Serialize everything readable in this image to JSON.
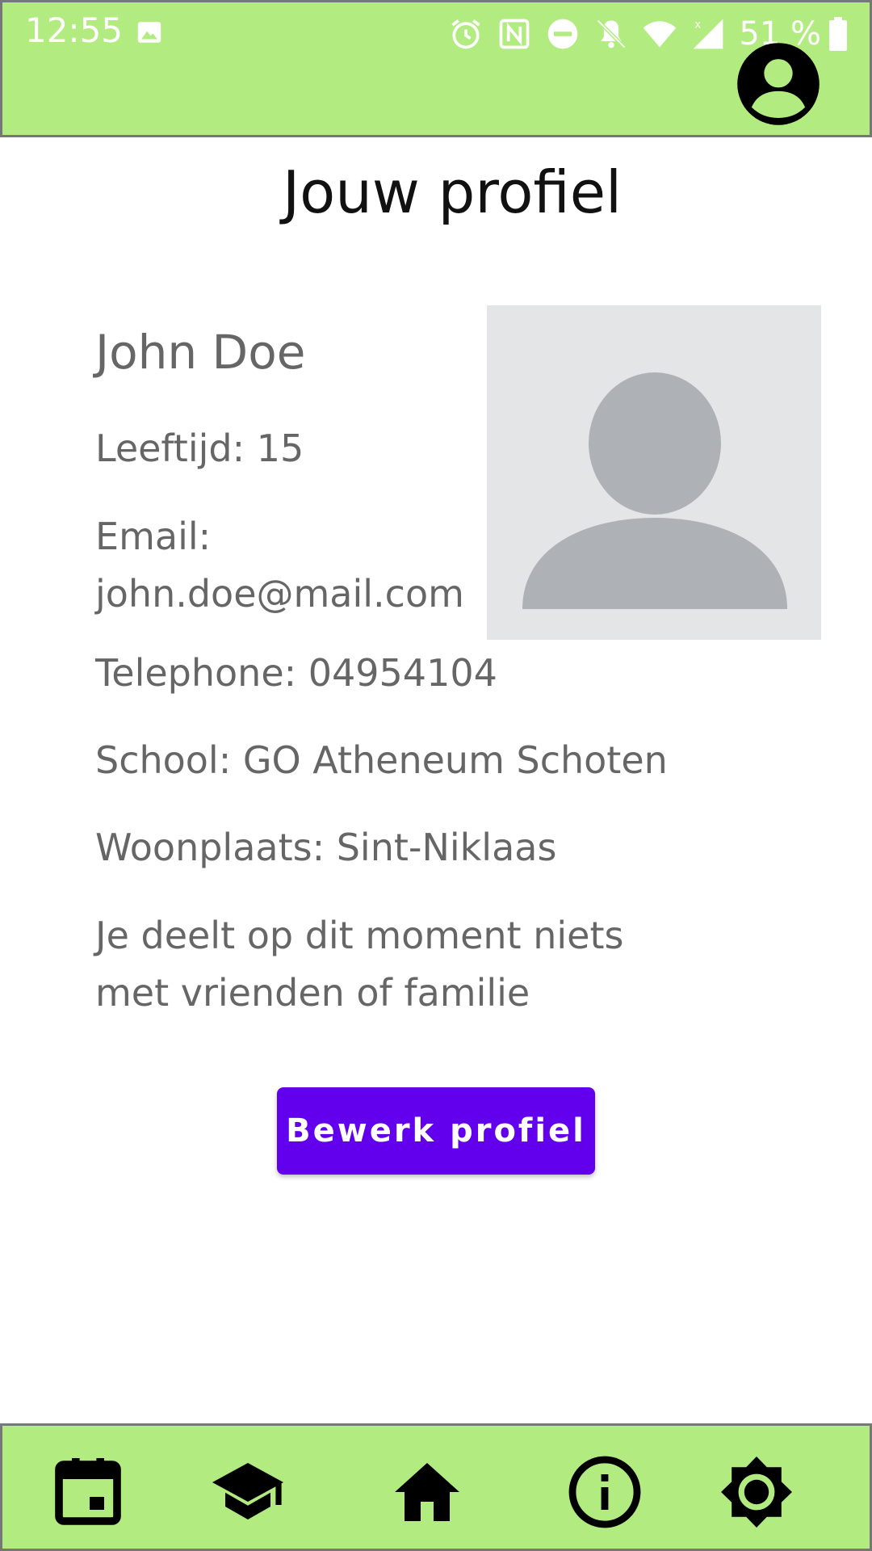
{
  "status_bar": {
    "time": "12:55",
    "battery": "51 %",
    "icons": [
      "image-icon",
      "alarm-icon",
      "nfc-icon",
      "dnd-icon",
      "bell-off-icon",
      "wifi-icon",
      "signal-icon",
      "battery-icon"
    ]
  },
  "top_bar": {
    "color": "#b2ec80",
    "account_icon": "account-circle-icon"
  },
  "page": {
    "title": "Jouw profiel"
  },
  "profile": {
    "name": "John Doe",
    "age_line": "Leeftijd: 15",
    "email_label": "Email:",
    "email_value": "john.doe@mail.com",
    "telephone_line": "Telephone: 04954104",
    "school_line": "School: GO Atheneum Schoten",
    "residence_line": "Woonplaats: Sint-Niklaas",
    "sharing_line_1": "Je deelt op dit moment niets",
    "sharing_line_2": "met vrienden of familie",
    "avatar_icon": "avatar-placeholder-icon"
  },
  "actions": {
    "edit_label": "Bewerk profiel",
    "edit_color": "#6200ee"
  },
  "bottom_nav": {
    "items": [
      {
        "name": "calendar",
        "icon": "calendar-icon"
      },
      {
        "name": "school",
        "icon": "graduation-cap-icon"
      },
      {
        "name": "home",
        "icon": "home-icon"
      },
      {
        "name": "info",
        "icon": "info-icon"
      },
      {
        "name": "brightness",
        "icon": "brightness-icon"
      }
    ]
  }
}
